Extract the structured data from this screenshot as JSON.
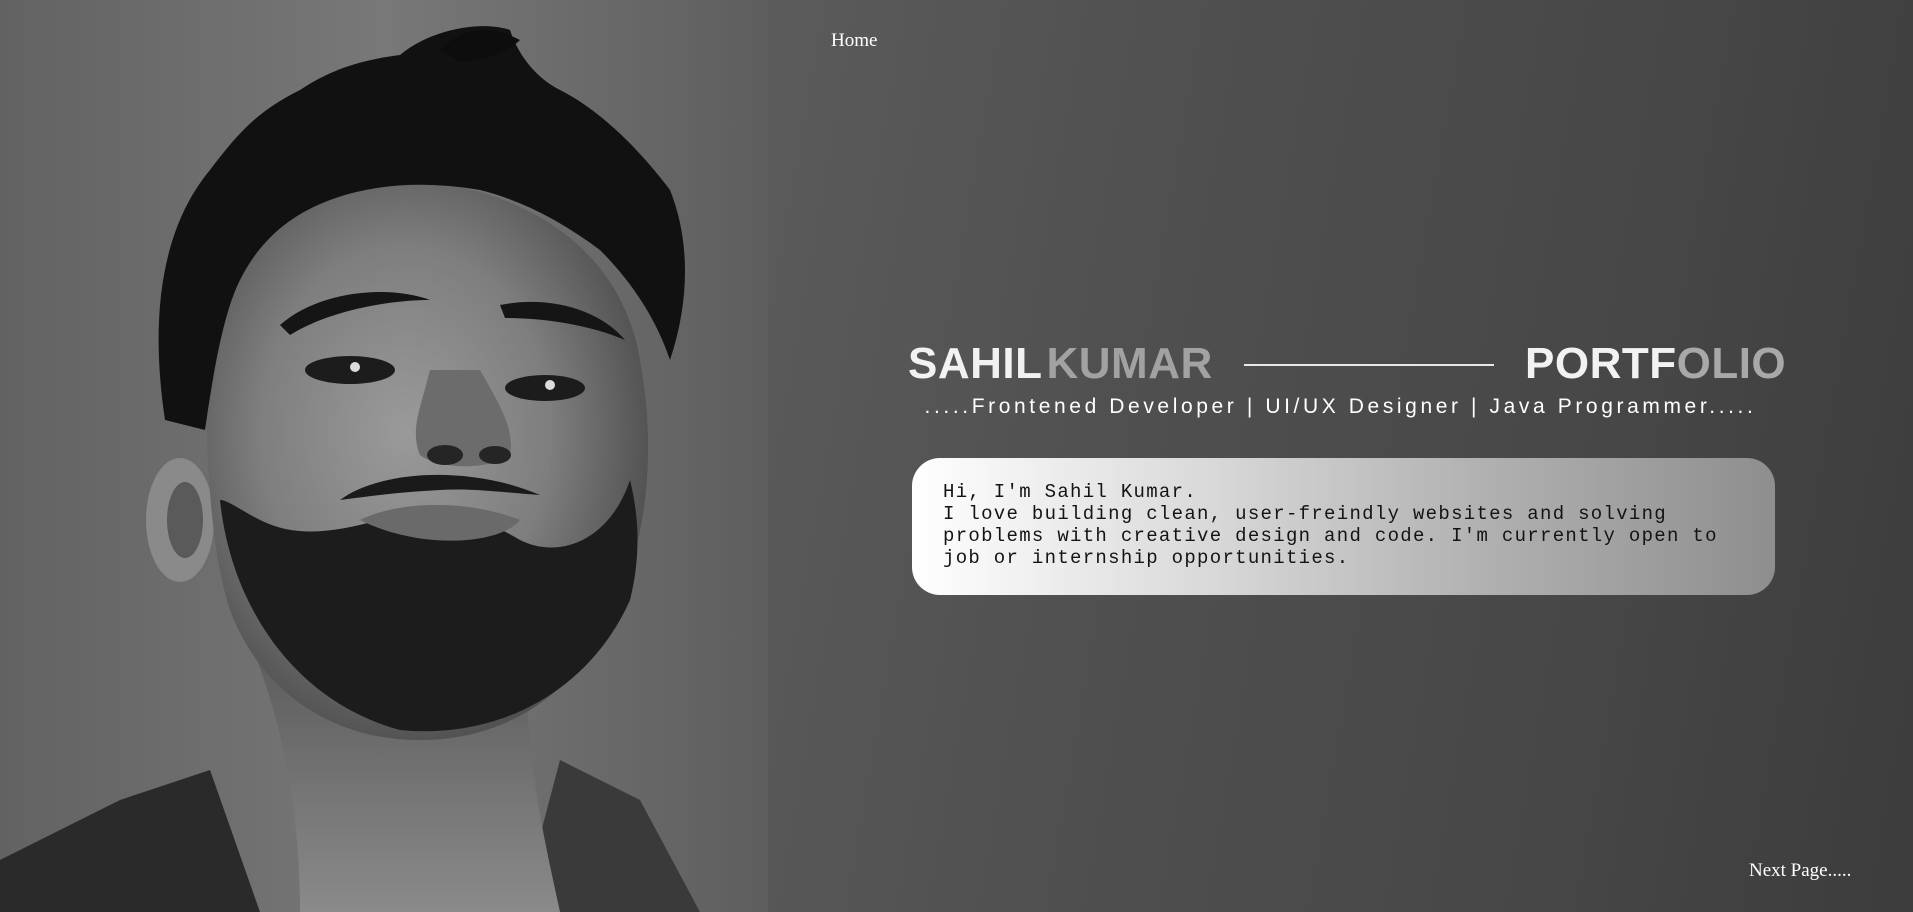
{
  "nav": {
    "home_label": "Home"
  },
  "hero": {
    "first_name": "SAHIL",
    "last_name": "KUMAR",
    "portfolio_part1": "PORTF",
    "portfolio_part2": "OLIO",
    "subtitle": ".....Frontened Developer | UI/UX Designer | Java Programmer....."
  },
  "intro": {
    "text": "Hi, I'm Sahil Kumar.\nI love building clean, user-freindly websites and solving problems with creative design and code. I'm currently open to job or internship opportunities."
  },
  "footer": {
    "next_label": "Next Page....."
  },
  "photo": {
    "subject": "portrait-photo"
  },
  "colors": {
    "panel_bg": "#4f4f4f",
    "accent_grey": "#a2a2a2",
    "text_white": "#ffffff"
  }
}
